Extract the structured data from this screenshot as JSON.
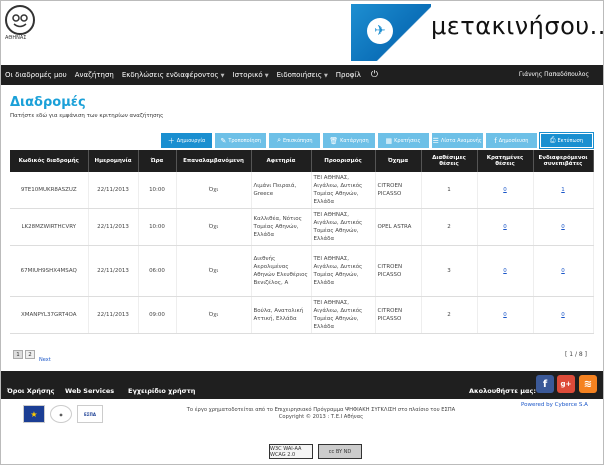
{
  "header": {
    "logo_text": "ΑΘΗΝΑΣ",
    "banner_text": "μετακινήσου..."
  },
  "nav": {
    "items": [
      {
        "label": "Οι διαδρομές μου",
        "dropdown": false
      },
      {
        "label": "Αναζήτηση",
        "dropdown": false
      },
      {
        "label": "Εκδηλώσεις ενδιαφέροντος",
        "dropdown": true
      },
      {
        "label": "Ιστορικό",
        "dropdown": true
      },
      {
        "label": "Ειδοποιήσεις",
        "dropdown": true
      },
      {
        "label": "Προφίλ",
        "dropdown": false
      }
    ],
    "user": "Γιάννης Παπαδόπουλος"
  },
  "page": {
    "title": "Διαδρομές",
    "subtitle": "Πατήστε εδώ για εμφάνιση των κριτηρίων αναζήτησης"
  },
  "toolbar": {
    "buttons": [
      {
        "label": "Δημιουργία",
        "icon": "plus-icon"
      },
      {
        "label": "Τροποποίηση",
        "icon": "pencil-icon"
      },
      {
        "label": "Επισκόπηση",
        "icon": "search-icon"
      },
      {
        "label": "Κατάργηση",
        "icon": "trash-icon"
      },
      {
        "label": "Κρατήσεις",
        "icon": "calendar-icon"
      },
      {
        "label": "Λίστα Αναμονής",
        "icon": "list-icon"
      },
      {
        "label": "Δημοσίευση",
        "icon": "facebook-icon"
      },
      {
        "label": "Εκτύπωση",
        "icon": "printer-icon"
      }
    ]
  },
  "table": {
    "headers": [
      "Κωδικός διαδρομής",
      "Ημερομηνία",
      "Ώρα",
      "Επαναλαμβανόμενη",
      "Αφετηρία",
      "Προορισμός",
      "Όχημα",
      "Διαθέσιμες θέσεις",
      "Κρατημένες θέσεις",
      "Ενδιαφερόμενοι συνεπιβάτες"
    ],
    "rows": [
      {
        "code": "9TE10MUKR8ASZUZ",
        "date": "22/11/2013",
        "time": "10:00",
        "repeat": "Όχι",
        "from": "Λιμάνι Πειραιά, Greece",
        "to": "ΤΕΙ ΑΘΗΝΑΣ, Αιγάλεω, Δυτικός Τομέας Αθηνών, Ελλάδα",
        "vehicle": "CITROEN PICASSO",
        "seats": "1",
        "reserved": "0",
        "interested": "1"
      },
      {
        "code": "LK28MZWIRTHCVRY",
        "date": "22/11/2013",
        "time": "10:00",
        "repeat": "Όχι",
        "from": "Καλλιθέα, Νότιος Τομέας Αθηνών, Ελλάδα",
        "to": "ΤΕΙ ΑΘΗΝΑΣ, Αιγάλεω, Δυτικός Τομέας Αθηνών, Ελλάδα",
        "vehicle": "OPEL ASTRA",
        "seats": "2",
        "reserved": "0",
        "interested": "0"
      },
      {
        "code": "67MIUH9SHX4MSAQ",
        "date": "22/11/2013",
        "time": "06:00",
        "repeat": "Όχι",
        "from": "Διεθνής Αερολιμένας Αθηνών Ελευθέριος Βενιζέλος, Α",
        "to": "ΤΕΙ ΑΘΗΝΑΣ, Αιγάλεω, Δυτικός Τομέας Αθηνών, Ελλάδα",
        "vehicle": "CITROEN PICASSO",
        "seats": "3",
        "reserved": "0",
        "interested": "0"
      },
      {
        "code": "XMANPYL37GRT4OA",
        "date": "22/11/2013",
        "time": "09:00",
        "repeat": "Όχι",
        "from": "Βούλα, Ανατολική Αττική, Ελλάδα",
        "to": "ΤΕΙ ΑΘΗΝΑΣ, Αιγάλεω, Δυτικός Τομέας Αθηνών, Ελλάδα",
        "vehicle": "CITROEN PICASSO",
        "seats": "2",
        "reserved": "0",
        "interested": "0"
      }
    ]
  },
  "pager": {
    "pages": [
      "1",
      "2"
    ],
    "next": "Next",
    "count": "[ 1 / 8 ]"
  },
  "footer": {
    "links": [
      "Όροι Χρήσης",
      "Web Services",
      "Εγχειρίδιο χρήστη"
    ],
    "follow": "Ακολουθήστε μας:",
    "funding": "Το έργο χρηματοδοτείται από το Επιχειρησιακό Πρόγραμμα ΨΗΦΙΑΚΗ ΣΥΓΚΛΙΣΗ στο πλαίσιο του ΕΣΠΑ",
    "copyright": "Copyright © 2013 : Τ.Ε.Ι Αθήνας",
    "powered": "Powered by Cyberce S.A",
    "espa": "ΕΣΠΑ",
    "badge_wcag": "W3C WAI-AA WCAG 2.0",
    "badge_cc": "cc BY ND"
  }
}
